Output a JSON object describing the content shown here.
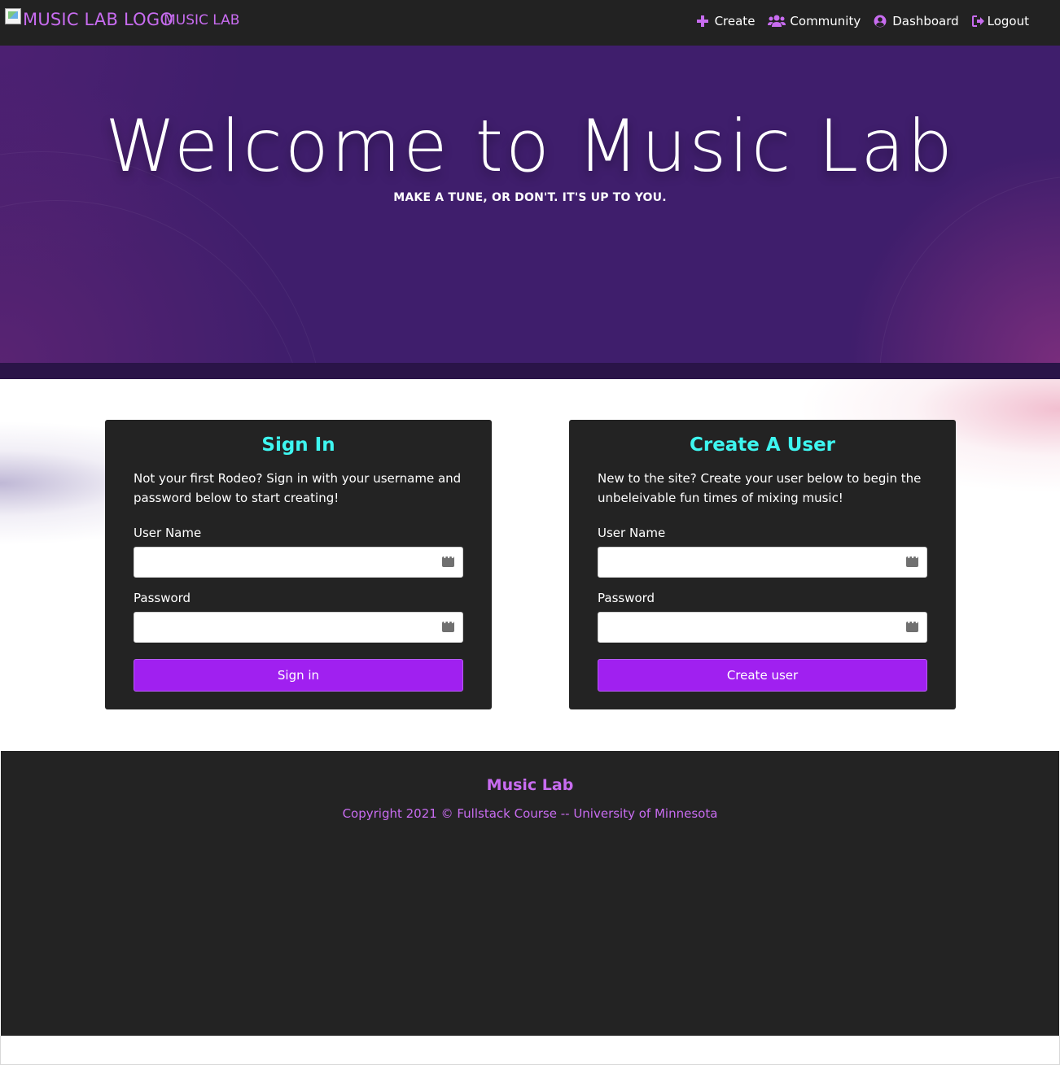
{
  "navbar": {
    "logo_alt": "MUSIC LAB LOGO",
    "brand_name": "MUSIC LAB",
    "links": [
      {
        "label": "Create",
        "icon": "plus-icon"
      },
      {
        "label": "Community",
        "icon": "users-icon"
      },
      {
        "label": "Dashboard",
        "icon": "user-circle-icon"
      },
      {
        "label": "Logout",
        "icon": "sign-out-icon"
      }
    ]
  },
  "hero": {
    "title": "Welcome to Music Lab",
    "subtitle": "MAKE A TUNE, OR DON'T. IT'S UP TO YOU."
  },
  "signin": {
    "title": "Sign In",
    "description": "Not your first Rodeo? Sign in with your username and password below to start creating!",
    "username_label": "User Name",
    "username_value": "",
    "password_label": "Password",
    "password_value": "",
    "button_label": "Sign in"
  },
  "signup": {
    "title": "Create A User",
    "description": "New to the site? Create your user below to begin the unbeleivable fun times of mixing music!",
    "username_label": "User Name",
    "username_value": "",
    "password_label": "Password",
    "password_value": "",
    "button_label": "Create user"
  },
  "footer": {
    "title": "Music Lab",
    "copyright": "Copyright 2021 © Fullstack Course -- University of Minnesota"
  },
  "colors": {
    "accent_purple": "#a020f0",
    "brand_pink": "#c86cf0",
    "card_title_cyan": "#3ef6f0",
    "dark_bg": "#222222",
    "hero_bg": "#3f1e6c"
  }
}
